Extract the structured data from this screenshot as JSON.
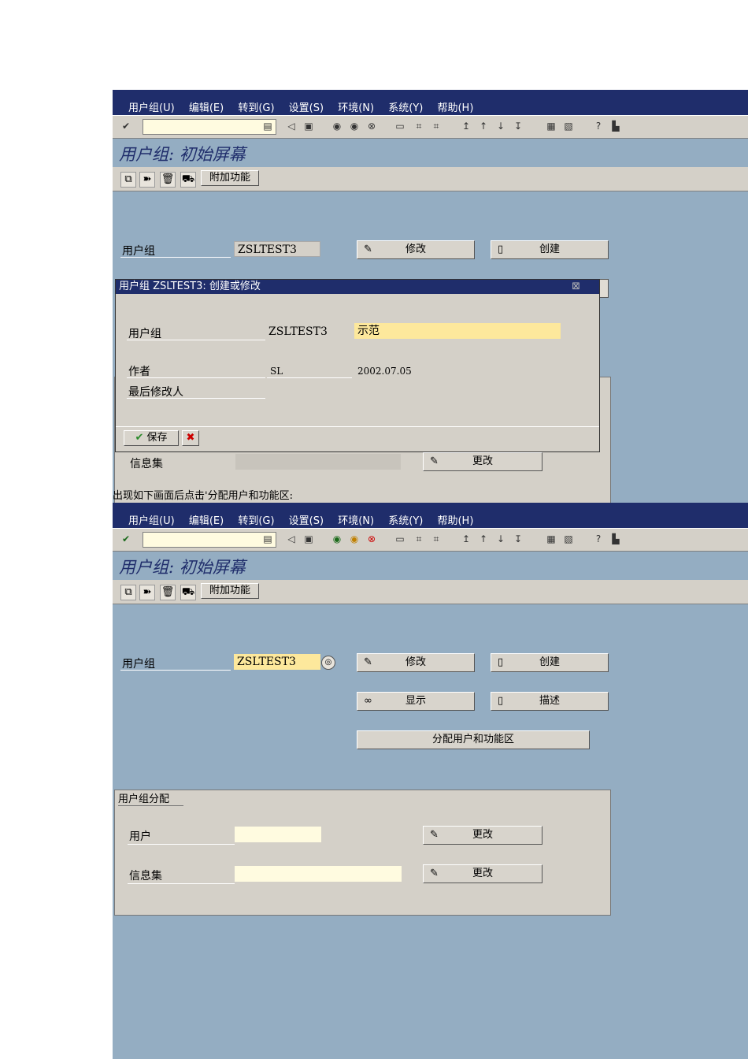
{
  "menu": [
    "用户组(U)",
    "编辑(E)",
    "转到(G)",
    "设置(S)",
    "环境(N)",
    "系统(Y)",
    "帮助(H)"
  ],
  "screen_title": "用户组: 初始屏幕",
  "app_toolbar": {
    "extras_label": "附加功能"
  },
  "screen1": {
    "usergroup_label": "用户组",
    "usergroup_value": "ZSLTEST3",
    "change_button": "修改",
    "create_button": "创建",
    "dialog": {
      "title": "用户组 ZSLTEST3: 创建或修改",
      "usergroup_label": "用户组",
      "usergroup_value": "ZSLTEST3",
      "description_value": "示范",
      "author_label": "作者",
      "author_value": "SL",
      "date_value": "2002.07.05",
      "last_changed_label": "最后修改人",
      "save_button": "保存"
    },
    "infoset_label": "信息集",
    "infoset_change_button": "更改"
  },
  "caption": "出现如下画面后点击'分配用户和功能区:",
  "screen2": {
    "usergroup_label": "用户组",
    "usergroup_value": "ZSLTEST3",
    "change_button": "修改",
    "create_button": "创建",
    "display_button": "显示",
    "describe_button": "描述",
    "assign_button": "分配用户和功能区",
    "group_title": "用户组分配",
    "user_label": "用户",
    "user_change_button": "更改",
    "infoset_label": "信息集",
    "infoset_change_button": "更改"
  }
}
